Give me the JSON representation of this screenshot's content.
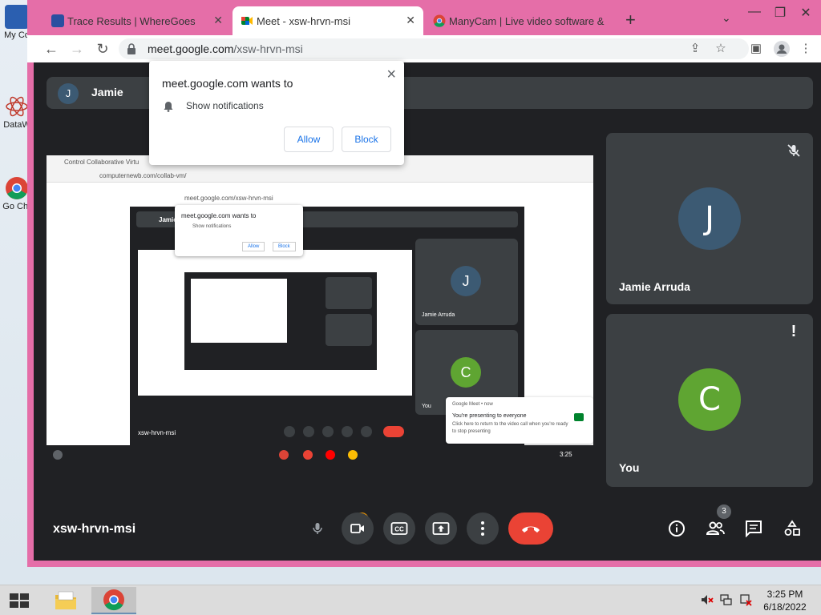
{
  "desktop": {
    "icons": [
      {
        "label": "My Co",
        "color": "#2b5fb0"
      },
      {
        "label": "DataW",
        "color": "#c0392b"
      },
      {
        "label": "Go Chr",
        "color": "#34a853"
      }
    ]
  },
  "browser": {
    "tabs": [
      {
        "title": "Trace Results | WhereGoes",
        "favicon": "wheregoes-icon",
        "active": false
      },
      {
        "title": "Meet - xsw-hrvn-msi",
        "favicon": "google-meet-icon",
        "active": true
      },
      {
        "title": "ManyCam | Live video software &",
        "favicon": "chrome-icon",
        "active": false
      }
    ],
    "url_host": "meet.google.com",
    "url_path": "/xsw-hrvn-msi"
  },
  "permission_popup": {
    "title": "meet.google.com wants to",
    "item": "Show notifications",
    "allow_label": "Allow",
    "block_label": "Block"
  },
  "meet": {
    "header_initial": "J",
    "header_name": "Jamie",
    "meeting_code": "xsw-hrvn-msi",
    "participant_count": "3",
    "participants": [
      {
        "initial": "J",
        "name": "Jamie Arruda",
        "avatar_color": "#3c5a73",
        "status_icon": "mic-off-icon"
      },
      {
        "initial": "C",
        "name": "You",
        "avatar_color": "#5fa532",
        "status_icon": "alert-icon"
      }
    ],
    "warning_glyph": "!"
  },
  "nested_capture": {
    "tab_title": "Control Collaborative Virtu",
    "url": "computernewb.com/collab-vm/",
    "inner_url": "meet.google.com/xsw-hrvn-msi",
    "inner_header_name": "Jamie",
    "popup_title": "meet.google.com wants to",
    "popup_item": "Show notifications",
    "popup_allow": "Allow",
    "popup_block": "Block",
    "tile1_initial": "J",
    "tile1_name": "Jamie Arruda",
    "tile2_initial": "C",
    "tile2_name": "You",
    "meeting_code": "xsw-hrvn-msi",
    "toast_app": "Google Meet • now",
    "toast_title": "You're presenting to everyone",
    "toast_body": "Click here to return to the video call when you're ready to stop presenting",
    "clock": "3:25"
  },
  "taskbar": {
    "time": "3:25 PM",
    "date": "6/18/2022"
  },
  "colors": {
    "chrome_frame": "#e56ea8",
    "meet_bg": "#202124",
    "tile_bg": "#3c4043",
    "end_call": "#ea4335",
    "link_blue": "#1a73e8"
  }
}
